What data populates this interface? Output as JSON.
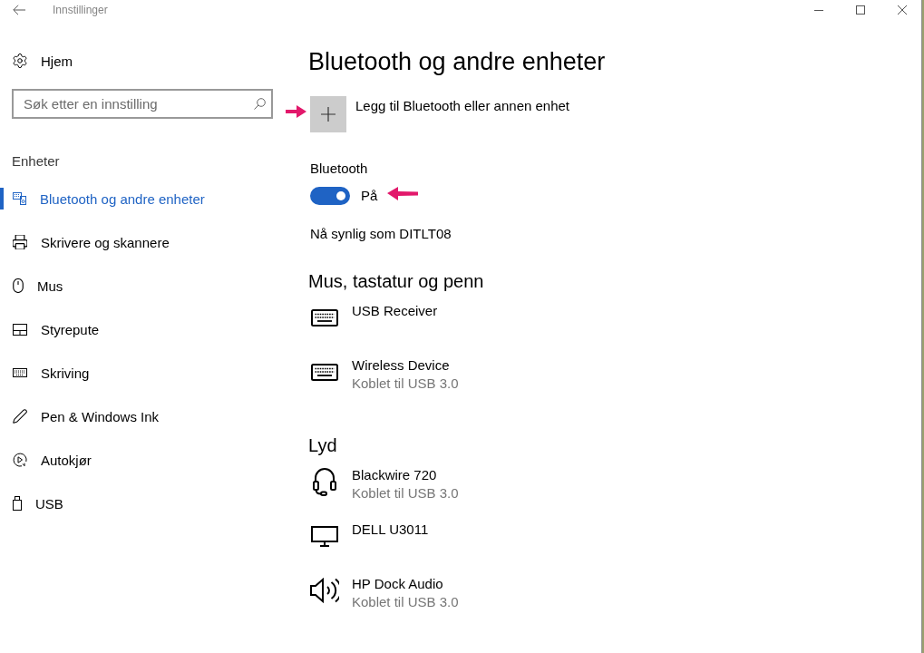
{
  "window": {
    "title": "Innstillinger"
  },
  "sidebar": {
    "home": "Hjem",
    "search": {
      "placeholder": "Søk etter en innstilling"
    },
    "section": "Enheter",
    "items": [
      {
        "label": "Bluetooth og andre enheter",
        "kind": "devices",
        "selected": true
      },
      {
        "label": "Skrivere og skannere",
        "kind": "printer",
        "selected": false
      },
      {
        "label": "Mus",
        "kind": "mouse",
        "selected": false
      },
      {
        "label": "Styrepute",
        "kind": "touchpad",
        "selected": false
      },
      {
        "label": "Skriving",
        "kind": "keyboard",
        "selected": false
      },
      {
        "label": "Pen & Windows Ink",
        "kind": "pen",
        "selected": false
      },
      {
        "label": "Autokjør",
        "kind": "autoplay",
        "selected": false
      },
      {
        "label": "USB",
        "kind": "usb",
        "selected": false
      }
    ]
  },
  "page": {
    "title": "Bluetooth og andre enheter",
    "add_device": "Legg til Bluetooth eller annen enhet",
    "bluetooth": {
      "label": "Bluetooth",
      "on": true,
      "state": "På"
    },
    "visibility": "Nå synlig som DITLT08"
  },
  "groups": [
    {
      "title": "Mus, tastatur og penn",
      "devices": [
        {
          "name": "USB Receiver",
          "kind": "keyboard"
        },
        {
          "name": "Wireless Device",
          "status": "Koblet til USB 3.0",
          "kind": "keyboard"
        }
      ]
    },
    {
      "title": "Lyd",
      "devices": [
        {
          "name": "Blackwire 720",
          "status": "Koblet til USB 3.0",
          "kind": "headset"
        },
        {
          "name": "DELL U3011",
          "kind": "monitor"
        },
        {
          "name": "HP Dock Audio",
          "status": "Koblet til USB 3.0",
          "kind": "speaker"
        }
      ]
    }
  ]
}
